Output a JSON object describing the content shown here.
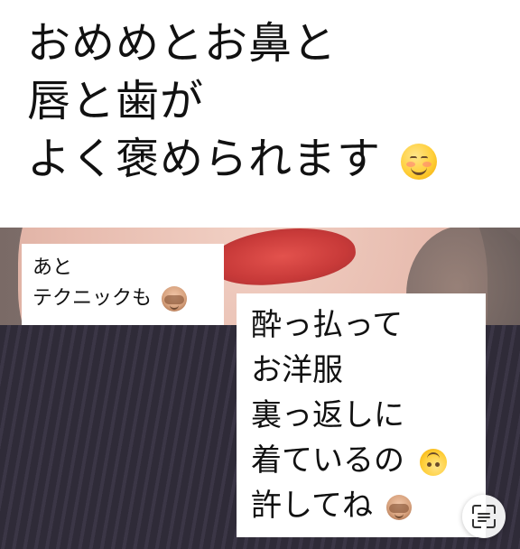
{
  "overlay": {
    "top_box": {
      "lines": [
        "おめめとお鼻と",
        "唇と歯が",
        "よく褒められます"
      ],
      "end_emoji": "smiling-face-with-blush-icon"
    },
    "mid_box": {
      "lines": [
        "あと",
        "テクニックも"
      ],
      "end_emoji": "see-no-evil-monkey-icon"
    },
    "bottom_box": {
      "lines": [
        "酔っ払って",
        "お洋服",
        "裏っ返しに",
        "着ているの",
        "許してね"
      ],
      "emoji_after_line_4": "upside-down-face-icon",
      "emoji_after_line_5": "see-no-evil-monkey-icon"
    }
  },
  "controls": {
    "scan_button_icon": "text-scan-icon"
  }
}
